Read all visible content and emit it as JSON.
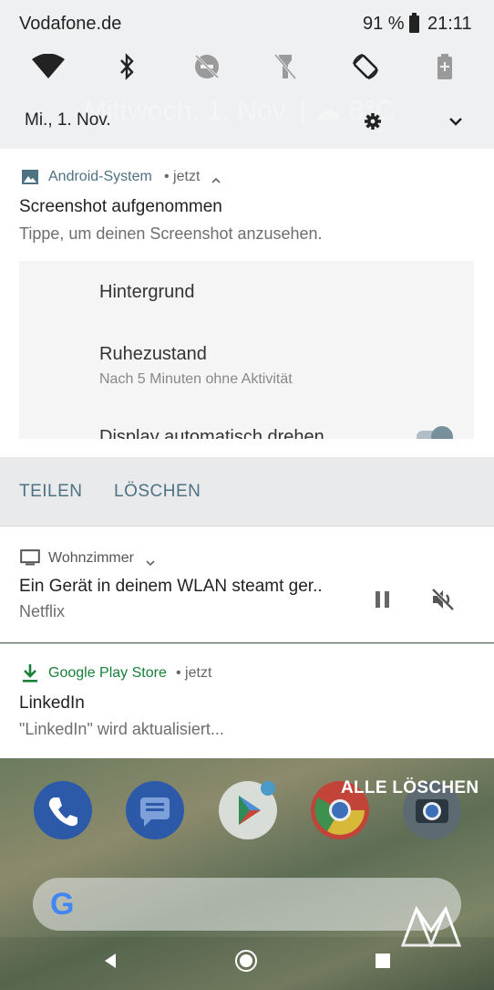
{
  "status_bar": {
    "carrier": "Vodafone.de",
    "battery": "91 %",
    "time": "21:11"
  },
  "quick_settings": {
    "date": "Mi., 1. Nov.",
    "ghost_text": "Mittwoch, 1. Nov. | ☁ 8°C",
    "tiles": [
      "wifi-icon",
      "bluetooth-icon",
      "do-not-disturb-off-icon",
      "flashlight-off-icon",
      "auto-rotate-icon",
      "battery-saver-icon"
    ]
  },
  "notifications": {
    "screenshot": {
      "app": "Android-System",
      "time": "• jetzt",
      "title": "Screenshot aufgenommen",
      "text": "Tippe, um deinen Screenshot anzusehen.",
      "preview": {
        "item1": "Hintergrund",
        "item2": "Ruhezustand",
        "item2_sub": "Nach 5 Minuten ohne Aktivität",
        "item3": "Display automatisch drehen"
      },
      "actions": [
        "TEILEN",
        "LÖSCHEN"
      ]
    },
    "cast": {
      "app": "Wohnzimmer",
      "title": "Ein Gerät in deinem WLAN steamt ger..",
      "text": "Netflix"
    },
    "playstore": {
      "app": "Google Play Store",
      "time": "• jetzt",
      "title": "LinkedIn",
      "text": "\"LinkedIn\" wird aktualisiert..."
    }
  },
  "home": {
    "clear_all": "ALLE LÖSCHEN",
    "google_letter": "G"
  },
  "colors": {
    "accent": "#4d7282",
    "playstore_green": "#188038",
    "panel_bg": "#eff0f1"
  }
}
